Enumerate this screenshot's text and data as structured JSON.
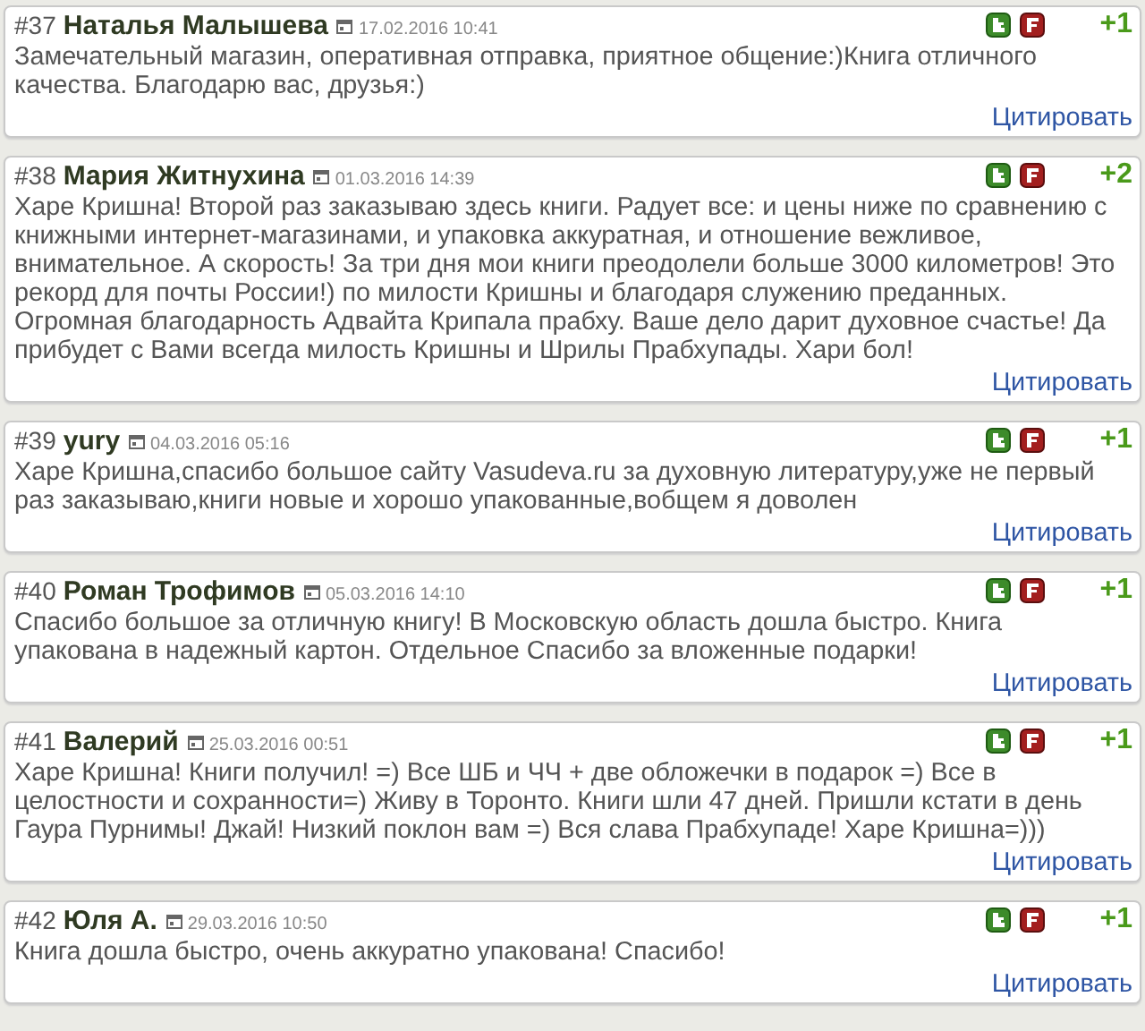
{
  "comments": [
    {
      "number": "#37",
      "author": "Наталья Малышева",
      "date": "17.02.2016 10:41",
      "text": "Замечательный магазин, оперативная отправка, приятное общение:)Книга отличного качества. Благодарю вас, друзья:)",
      "rating": "+1",
      "quote": "Цитировать"
    },
    {
      "number": "#38",
      "author": "Мария Житнухина",
      "date": "01.03.2016 14:39",
      "text": "Харе Кришна! Второй раз заказываю здесь книги. Радует все: и цены ниже по сравнению с книжными интернет-магазинами, и упаковка аккуратная, и отношение вежливое, внимательное. А скорость! За три дня мои книги преодолели больше 3000 километров! Это рекорд для почты России!) по милости Кришны и благодаря служению преданных. Огромная благодарность Адвайта Крипала прабху. Ваше дело дарит духовное счастье! Да прибудет с Вами всегда милость Кришны и Шрилы Прабхупады. Хари бол!",
      "rating": "+2",
      "quote": "Цитировать"
    },
    {
      "number": "#39",
      "author": "yury",
      "date": "04.03.2016 05:16",
      "text": "Харе Кришна,спасибо большое сайту Vasudeva.ru за духовную литературу,уже не первый раз заказываю,книги новые и хорошо упакованные,вобщем я доволен",
      "rating": "+1",
      "quote": "Цитировать"
    },
    {
      "number": "#40",
      "author": "Роман Трофимов",
      "date": "05.03.2016 14:10",
      "text": "Спасибо большое за отличную книгу! В Московскую область дошла быстро. Книга упакована в надежный картон. Отдельное Спасибо за вложенные подарки!",
      "rating": "+1",
      "quote": "Цитировать"
    },
    {
      "number": "#41",
      "author": "Валерий",
      "date": "25.03.2016 00:51",
      "text": "Харе Кришна! Книги получил! =) Все ШБ и ЧЧ + две обложечки в подарок =) Все в целостности и сохранности=) Живу в Торонто. Книги шли 47 дней. Пришли кстати в день Гаура Пурнимы! Джай! Низкий поклон вам =) Вся слава Прабхупаде! Харе Кришна=)))",
      "rating": "+1",
      "quote": "Цитировать"
    },
    {
      "number": "#42",
      "author": "Юля А.",
      "date": "29.03.2016 10:50",
      "text": "Книга дошла быстро, очень аккуратно упакована! Спасибо!",
      "rating": "+1",
      "quote": "Цитировать"
    }
  ]
}
